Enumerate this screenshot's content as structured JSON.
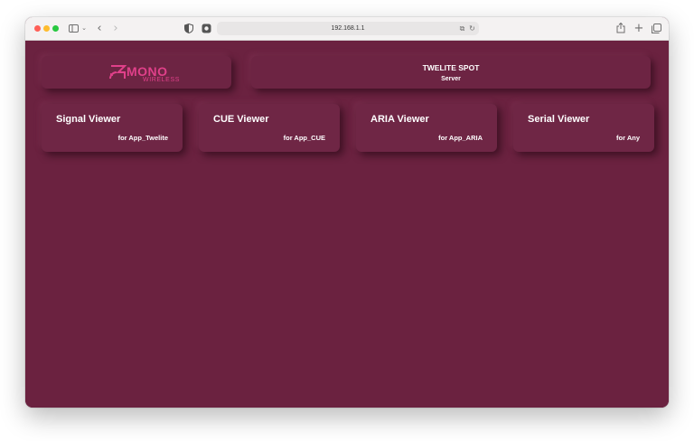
{
  "browser": {
    "url": "192.168.1.1",
    "icons": {
      "sidebar": "sidebar-icon",
      "back": "chevron-left-icon",
      "forward": "chevron-right-icon",
      "privacy": "shield-icon",
      "extension": "extension-icon",
      "translate": "translate-icon",
      "reload": "reload-icon",
      "share": "share-icon",
      "new_tab": "plus-icon",
      "tabs": "tabs-overview-icon"
    },
    "traffic_lights": [
      "#ff5f57",
      "#febc2e",
      "#28c840"
    ]
  },
  "header": {
    "logo": {
      "mono": "MONO",
      "wireless": "WIRELESS"
    },
    "title": "TWELITE SPOT",
    "subtitle": "Server"
  },
  "cards": [
    {
      "title": "Signal Viewer",
      "subtitle": "for App_Twelite"
    },
    {
      "title": "CUE Viewer",
      "subtitle": "for App_CUE"
    },
    {
      "title": "ARIA Viewer",
      "subtitle": "for App_ARIA"
    },
    {
      "title": "Serial Viewer",
      "subtitle": "for Any"
    }
  ],
  "colors": {
    "background": "#6b2240",
    "logo": "#e0408a",
    "text": "#ffffff"
  }
}
